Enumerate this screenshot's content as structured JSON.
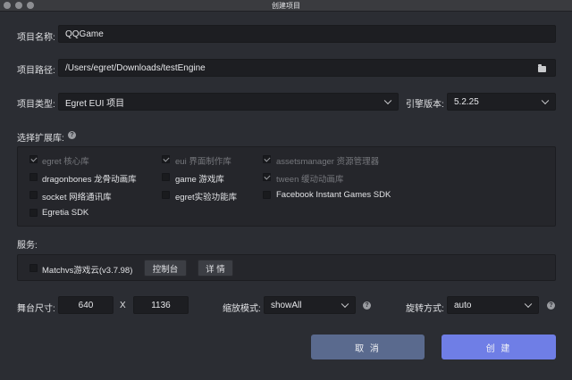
{
  "window": {
    "title": "创建项目"
  },
  "project_name": {
    "label": "项目名称:",
    "value": "QQGame"
  },
  "project_path": {
    "label": "项目路径:",
    "value": "/Users/egret/Downloads/testEngine",
    "icon": "folder-icon"
  },
  "project_type": {
    "label": "项目类型:",
    "value": "Egret EUI 项目"
  },
  "engine_version": {
    "label": "引擎版本:",
    "value": "5.2.25"
  },
  "extensions": {
    "label": "选择扩展库:",
    "help": "?",
    "items": [
      {
        "label": "egret 核心库",
        "checked": true,
        "disabled": true
      },
      {
        "label": "eui 界面制作库",
        "checked": true,
        "disabled": true
      },
      {
        "label": "assetsmanager 资源管理器",
        "checked": true,
        "disabled": true
      },
      {
        "label": "dragonbones 龙骨动画库",
        "checked": false,
        "disabled": false
      },
      {
        "label": "game 游戏库",
        "checked": false,
        "disabled": false
      },
      {
        "label": "tween 缓动动画库",
        "checked": true,
        "disabled": true
      },
      {
        "label": "socket 网络通讯库",
        "checked": false,
        "disabled": false
      },
      {
        "label": "egret实验功能库",
        "checked": false,
        "disabled": false
      },
      {
        "label": "Facebook Instant Games SDK",
        "checked": false,
        "disabled": false
      },
      {
        "label": "Egretia SDK",
        "checked": false,
        "disabled": false
      }
    ]
  },
  "services": {
    "label": "服务:",
    "item_label": "Matchvs游戏云(v3.7.98)",
    "console_button": "控制台",
    "details_button": "详 情"
  },
  "stage_size": {
    "label": "舞台尺寸:",
    "width": "640",
    "separator": "X",
    "height": "1136"
  },
  "scale_mode": {
    "label": "缩放模式:",
    "value": "showAll",
    "help": "?"
  },
  "orientation": {
    "label": "旋转方式:",
    "value": "auto",
    "help": "?"
  },
  "actions": {
    "cancel": "取 消",
    "create": "创 建"
  },
  "colors": {
    "cancel_bg": "#5a6a8e",
    "create_bg": "#6f7ee6",
    "background": "#2b2d33"
  }
}
